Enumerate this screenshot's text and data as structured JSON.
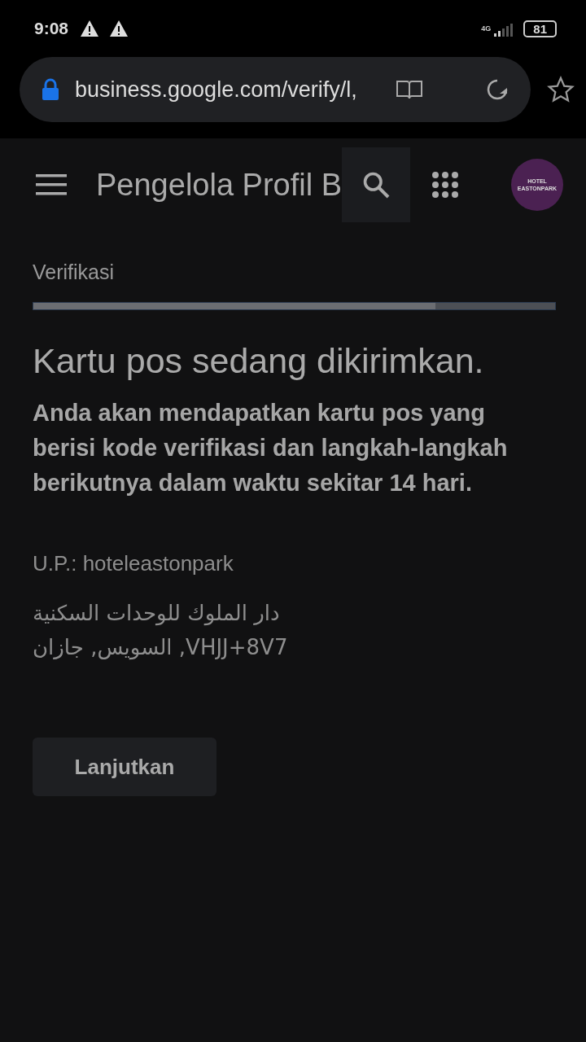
{
  "status_bar": {
    "time": "9:08",
    "network": "4G",
    "battery": "81"
  },
  "browser": {
    "url": "business.google.com/verify/l,"
  },
  "app_bar": {
    "title": "Pengelola Profil B",
    "avatar": {
      "lines": [
        "HOTEL",
        "EASTONPARK"
      ]
    }
  },
  "section_label": "Verifikasi",
  "progress": {
    "level": 0.77
  },
  "heading": "Kartu pos sedang dikirimkan.",
  "description": "Anda akan mendapatkan kartu pos yang berisi kode verifikasi dan langkah-langkah berikutnya dalam waktu sekitar 14 hari.",
  "account": "U.P.: hoteleastonpark",
  "address": [
    "دار الملوك للوحدات السكنية",
    "VHJJ+8V7, السويس, جازان"
  ],
  "button": "Lanjutkan"
}
